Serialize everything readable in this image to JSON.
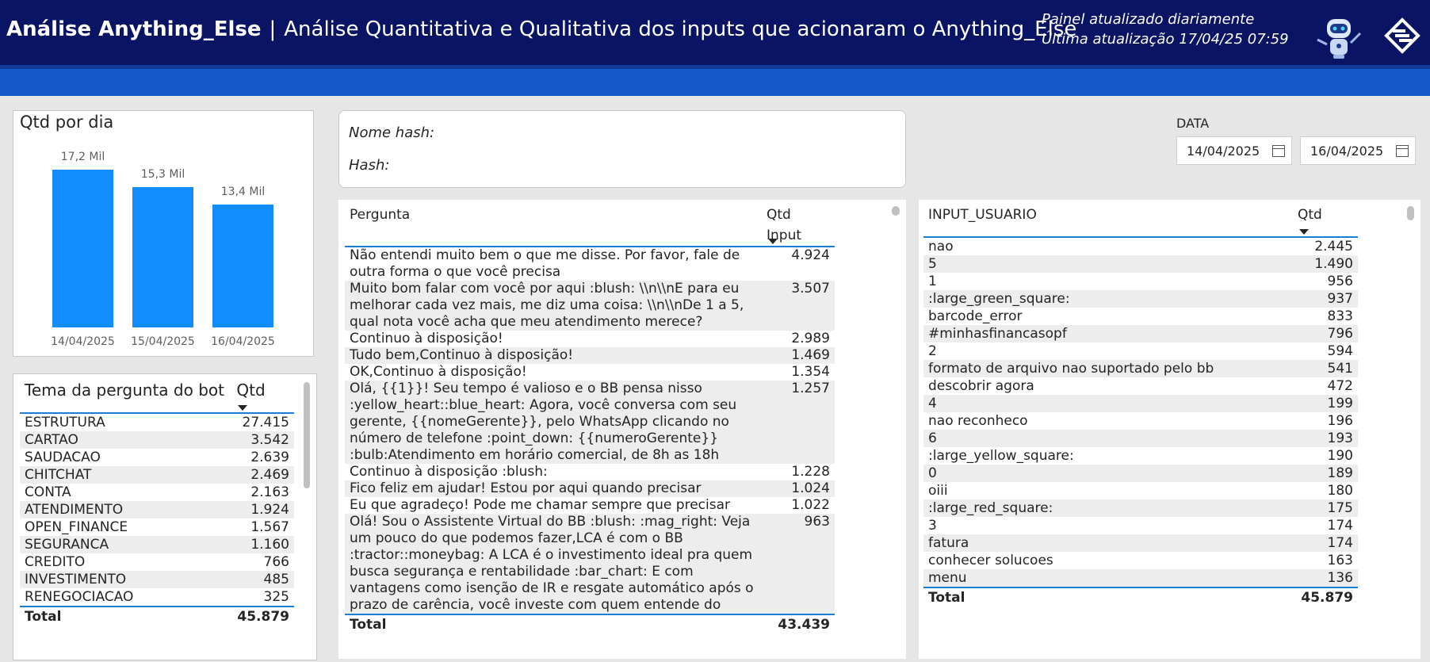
{
  "header": {
    "title_bold": "Análise Anything_Else",
    "separator": "|",
    "title_rest": "Análise Quantitativa e Qualitativa dos inputs que acionaram o Anything_Else",
    "info_line1": "Painel atualizado diariamente",
    "info_line2": "Última atualização  17/04/25 07:59",
    "robot_icon": "robot-icon",
    "logo_icon": "bb-logo-icon"
  },
  "chart_card": {
    "title": "Qtd por dia"
  },
  "chart_data": {
    "type": "bar",
    "title": "Qtd por dia",
    "categories": [
      "14/04/2025",
      "15/04/2025",
      "16/04/2025"
    ],
    "values": [
      17200,
      15300,
      13400
    ],
    "data_labels": [
      "17,2 Mil",
      "15,3 Mil",
      "13,4 Mil"
    ],
    "ylim": [
      0,
      17200
    ],
    "bar_color": "#118dff",
    "grid": false
  },
  "tema": {
    "col1": "Tema da pergunta do bot",
    "col2": "Qtd",
    "rows": [
      {
        "label": "ESTRUTURA",
        "value": "27.415"
      },
      {
        "label": "CARTAO",
        "value": "3.542"
      },
      {
        "label": "SAUDACAO",
        "value": "2.639"
      },
      {
        "label": "CHITCHAT",
        "value": "2.469"
      },
      {
        "label": "CONTA",
        "value": "2.163"
      },
      {
        "label": "ATENDIMENTO",
        "value": "1.924"
      },
      {
        "label": "OPEN_FINANCE",
        "value": "1.567"
      },
      {
        "label": "SEGURANCA",
        "value": "1.160"
      },
      {
        "label": "CREDITO",
        "value": "766"
      },
      {
        "label": "INVESTIMENTO",
        "value": "485"
      },
      {
        "label": "RENEGOCIACAO",
        "value": "325"
      }
    ],
    "total_label": "Total",
    "total_value": "45.879"
  },
  "hash": {
    "nome_label": "Nome hash:",
    "hash_label": "Hash:"
  },
  "date_filter": {
    "label": "DATA",
    "start": "14/04/2025",
    "end": "16/04/2025",
    "icon": "calendar-icon"
  },
  "perguntas": {
    "col1": "Pergunta",
    "col2": "Qtd Input",
    "rows": [
      {
        "text": "Não entendi muito bem o que me disse. Por favor, fale de outra forma o que você precisa",
        "value": "4.924"
      },
      {
        "text": "Muito bom falar com você por aqui :blush: \\\\n\\\\nE para eu melhorar cada vez mais, me diz uma coisa: \\\\n\\\\nDe 1 a 5, qual nota você acha que meu atendimento merece?",
        "value": "3.507"
      },
      {
        "text": "Continuo à disposição!",
        "value": "2.989"
      },
      {
        "text": "Tudo bem,Continuo à disposição!",
        "value": "1.469"
      },
      {
        "text": "OK,Continuo à disposição!",
        "value": "1.354"
      },
      {
        "text": "Olá, {{1}}! Seu tempo é valioso e o BB pensa nisso :yellow_heart::blue_heart: Agora, você conversa com seu gerente, {{nomeGerente}}, pelo WhatsApp clicando no número de telefone :point_down: {{numeroGerente}} :bulb:Atendimento em horário comercial, de 8h as 18h",
        "value": "1.257"
      },
      {
        "text": "Continuo à disposição :blush:",
        "value": "1.228"
      },
      {
        "text": "Fico feliz em ajudar! Estou por aqui quando precisar",
        "value": "1.024"
      },
      {
        "text": "Eu que agradeço! Pode me chamar sempre que precisar",
        "value": "1.022"
      },
      {
        "text": "Olá! Sou o Assistente Virtual do BB :blush: :mag_right: Veja um pouco do que podemos fazer,LCA é com o BB :tractor::moneybag: A LCA é o investimento ideal pra quem busca segurança e rentabilidade :bar_chart: E com vantagens como isenção de IR e resgate automático após o prazo de carência, você investe com quem entende do",
        "value": "963"
      }
    ],
    "total_label": "Total",
    "total_value": "43.439"
  },
  "inputs": {
    "col1": "INPUT_USUARIO",
    "col2": "Qtd",
    "rows": [
      {
        "text": "nao",
        "value": "2.445"
      },
      {
        "text": "5",
        "value": "1.490"
      },
      {
        "text": "1",
        "value": "956"
      },
      {
        "text": ":large_green_square:",
        "value": "937"
      },
      {
        "text": "barcode_error",
        "value": "833"
      },
      {
        "text": "#minhasfinancasopf",
        "value": "796"
      },
      {
        "text": "2",
        "value": "594"
      },
      {
        "text": "formato de arquivo nao suportado pelo bb",
        "value": "541"
      },
      {
        "text": "descobrir agora",
        "value": "472"
      },
      {
        "text": "4",
        "value": "199"
      },
      {
        "text": "nao reconheco",
        "value": "196"
      },
      {
        "text": "6",
        "value": "193"
      },
      {
        "text": ":large_yellow_square:",
        "value": "190"
      },
      {
        "text": "0",
        "value": "189"
      },
      {
        "text": "oiii",
        "value": "180"
      },
      {
        "text": ":large_red_square:",
        "value": "175"
      },
      {
        "text": "3",
        "value": "174"
      },
      {
        "text": "fatura",
        "value": "174"
      },
      {
        "text": "conhecer solucoes",
        "value": "163"
      },
      {
        "text": "menu",
        "value": "136"
      }
    ],
    "total_label": "Total",
    "total_value": "45.879"
  }
}
